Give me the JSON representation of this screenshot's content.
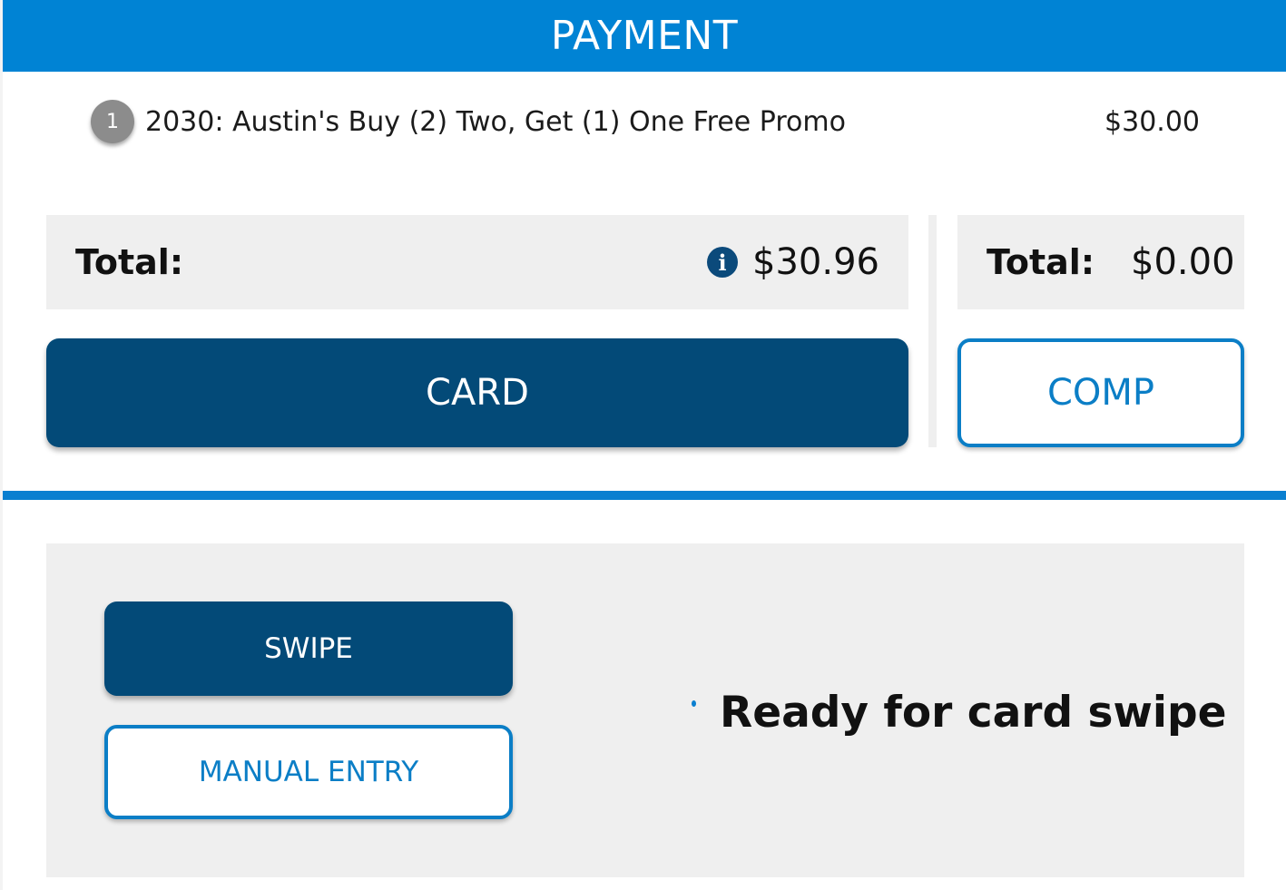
{
  "header": {
    "title": "PAYMENT"
  },
  "line_items": [
    {
      "quantity": "1",
      "name": "2030: Austin's Buy (2) Two, Get (1) One Free Promo",
      "price": "$30.00"
    }
  ],
  "totals": {
    "main": {
      "label": "Total:",
      "value": "$30.96",
      "info_icon": "info-circle-icon"
    },
    "comp": {
      "label": "Total:",
      "value": "$0.00"
    }
  },
  "payment_methods": {
    "card_label": "CARD",
    "comp_label": "COMP"
  },
  "card_entry": {
    "swipe_label": "SWIPE",
    "manual_entry_label": "MANUAL ENTRY",
    "status_text": "Ready for card swipe"
  },
  "colors": {
    "header": "#0083d4",
    "primary_button": "#034a78",
    "accent": "#0b7ec6",
    "panel": "#efefef"
  }
}
